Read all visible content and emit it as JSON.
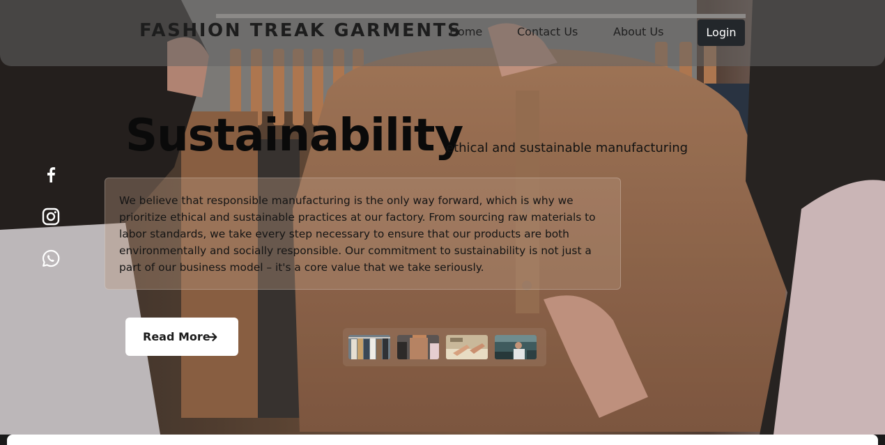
{
  "navbar": {
    "brand": "FASHION TREAK GARMENTS",
    "links": [
      "Home",
      "Contact Us",
      "About Us"
    ],
    "login_label": "Login"
  },
  "hero": {
    "title": "Sustainability",
    "subtitle": "ethical and sustainable manufacturing",
    "body": "We believe that responsible manufacturing is the only way forward, which is why we prioritize ethical and sustainable practices at our factory. From sourcing raw materials to labor standards, we take every step necessary to ensure that our products are both environmentally and socially responsible. Our commitment to sustainability is not just a part of our business model – it's a core value that we take seriously.",
    "read_more_label": "Read More"
  },
  "social": [
    "facebook-icon",
    "instagram-icon",
    "whatsapp-icon"
  ],
  "thumbnails": [
    {
      "name": "thumbnail-clothing-rack"
    },
    {
      "name": "thumbnail-shirt-fitting"
    },
    {
      "name": "thumbnail-sewing"
    },
    {
      "name": "thumbnail-factory-worker"
    }
  ],
  "colors": {
    "accent_dark": "#23272b",
    "hero_tint": "#6b4a36"
  }
}
